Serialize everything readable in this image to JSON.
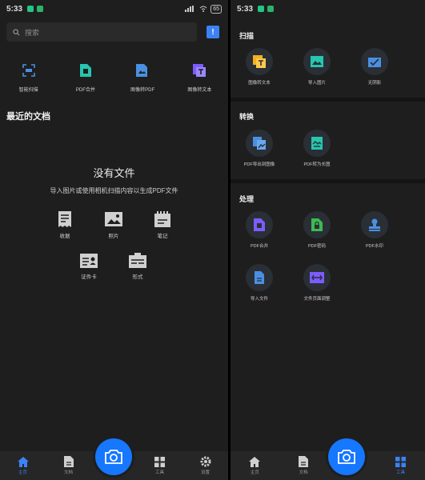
{
  "left": {
    "status": {
      "time": "5:33",
      "battery": "65"
    },
    "search": {
      "placeholder": "搜索"
    },
    "feedback_icon": "feedback-icon",
    "quick_actions": [
      {
        "label": "智能扫描",
        "icon": "scan-icon",
        "color": "#4a90e2"
      },
      {
        "label": "PDF合并",
        "icon": "pdf-merge-icon",
        "color": "#26c6b0"
      },
      {
        "label": "图像转PDF",
        "icon": "image-to-pdf-icon",
        "color": "#4a90e2"
      },
      {
        "label": "图像转文本",
        "icon": "image-to-text-icon",
        "color": "#7c5cff"
      }
    ],
    "recent_title": "最近的文档",
    "empty_title": "没有文件",
    "empty_desc": "导入图片或使用相机扫描内容以生成PDF文件",
    "categories": [
      {
        "label": "收据",
        "icon": "receipt-icon"
      },
      {
        "label": "照片",
        "icon": "photo-icon"
      },
      {
        "label": "笔记",
        "icon": "notebook-icon"
      },
      {
        "label": "证件卡",
        "icon": "id-card-icon"
      },
      {
        "label": "形式",
        "icon": "form-icon"
      }
    ],
    "tabs": [
      {
        "label": "主页",
        "icon": "home-icon",
        "active": true
      },
      {
        "label": "文档",
        "icon": "document-icon",
        "active": false
      },
      {
        "label": "工具",
        "icon": "tools-icon",
        "active": false
      },
      {
        "label": "设置",
        "icon": "settings-icon",
        "active": false
      }
    ],
    "camera_icon": "camera-icon"
  },
  "right": {
    "status": {
      "time": "5:33"
    },
    "sections": [
      {
        "title": "扫描",
        "tools": [
          {
            "label": "图像转文本",
            "icon": "image-to-text-icon",
            "color": "#f5b021"
          },
          {
            "label": "导入图片",
            "icon": "import-image-icon",
            "color": "#26c6b0"
          },
          {
            "label": "无阴影",
            "icon": "no-shadow-icon",
            "color": "#4a90e2"
          }
        ]
      },
      {
        "title": "转换",
        "tools": [
          {
            "label": "PDF导出到图像",
            "icon": "pdf-to-image-icon",
            "color": "#4a90e2"
          },
          {
            "label": "PDF转为长图",
            "icon": "pdf-to-long-image-icon",
            "color": "#26c6b0"
          }
        ]
      },
      {
        "title": "处理",
        "tools": [
          {
            "label": "PDF合并",
            "icon": "pdf-merge-icon",
            "color": "#7c5cff"
          },
          {
            "label": "PDF密码",
            "icon": "pdf-password-icon",
            "color": "#3fb950"
          },
          {
            "label": "PDF水印",
            "icon": "pdf-watermark-icon",
            "color": "#4a90e2"
          },
          {
            "label": "导入文件",
            "icon": "import-file-icon",
            "color": "#4a90e2"
          },
          {
            "label": "文件页面调整",
            "icon": "page-adjust-icon",
            "color": "#7c5cff"
          }
        ]
      }
    ],
    "tabs": [
      {
        "label": "主页",
        "icon": "home-icon",
        "active": false
      },
      {
        "label": "文档",
        "icon": "document-icon",
        "active": false
      },
      {
        "label": "工具",
        "icon": "tools-icon",
        "active": true
      }
    ]
  }
}
